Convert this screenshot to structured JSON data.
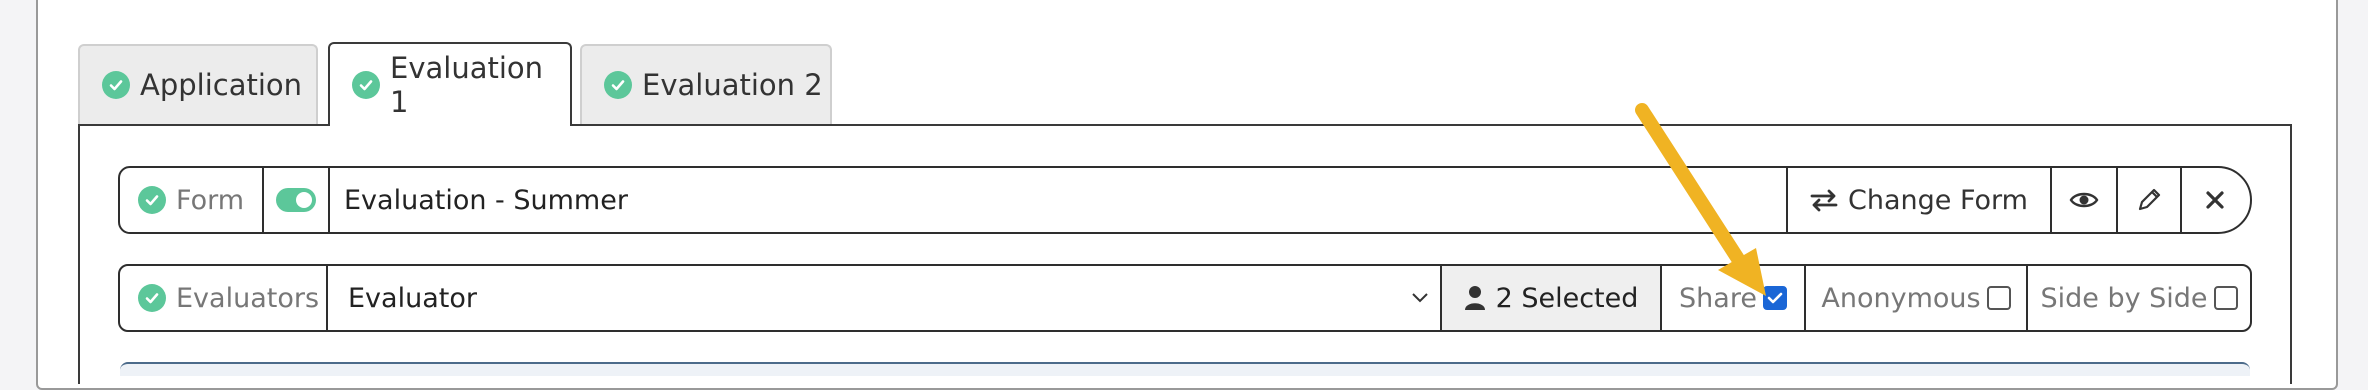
{
  "tabs": [
    {
      "label": "Application",
      "active": false
    },
    {
      "label": "Evaluation 1",
      "active": true
    },
    {
      "label": "Evaluation 2",
      "active": false
    }
  ],
  "form_row": {
    "label": "Form",
    "toggle_on": true,
    "value": "Evaluation - Summer",
    "change_form_label": "Change Form",
    "icons": [
      "exchange-icon",
      "eye-icon",
      "pencil-icon",
      "close-icon"
    ]
  },
  "evaluators_row": {
    "label": "Evaluators",
    "select_value": "Evaluator",
    "selected_label": "2 Selected",
    "share_label": "Share",
    "share_checked": true,
    "anonymous_label": "Anonymous",
    "anonymous_checked": false,
    "side_by_side_label": "Side by Side",
    "side_by_side_checked": false
  },
  "colors": {
    "accent_green": "#5cc79a",
    "annotation_arrow": "#f0b323",
    "checkbox_blue": "#1a66d6"
  }
}
